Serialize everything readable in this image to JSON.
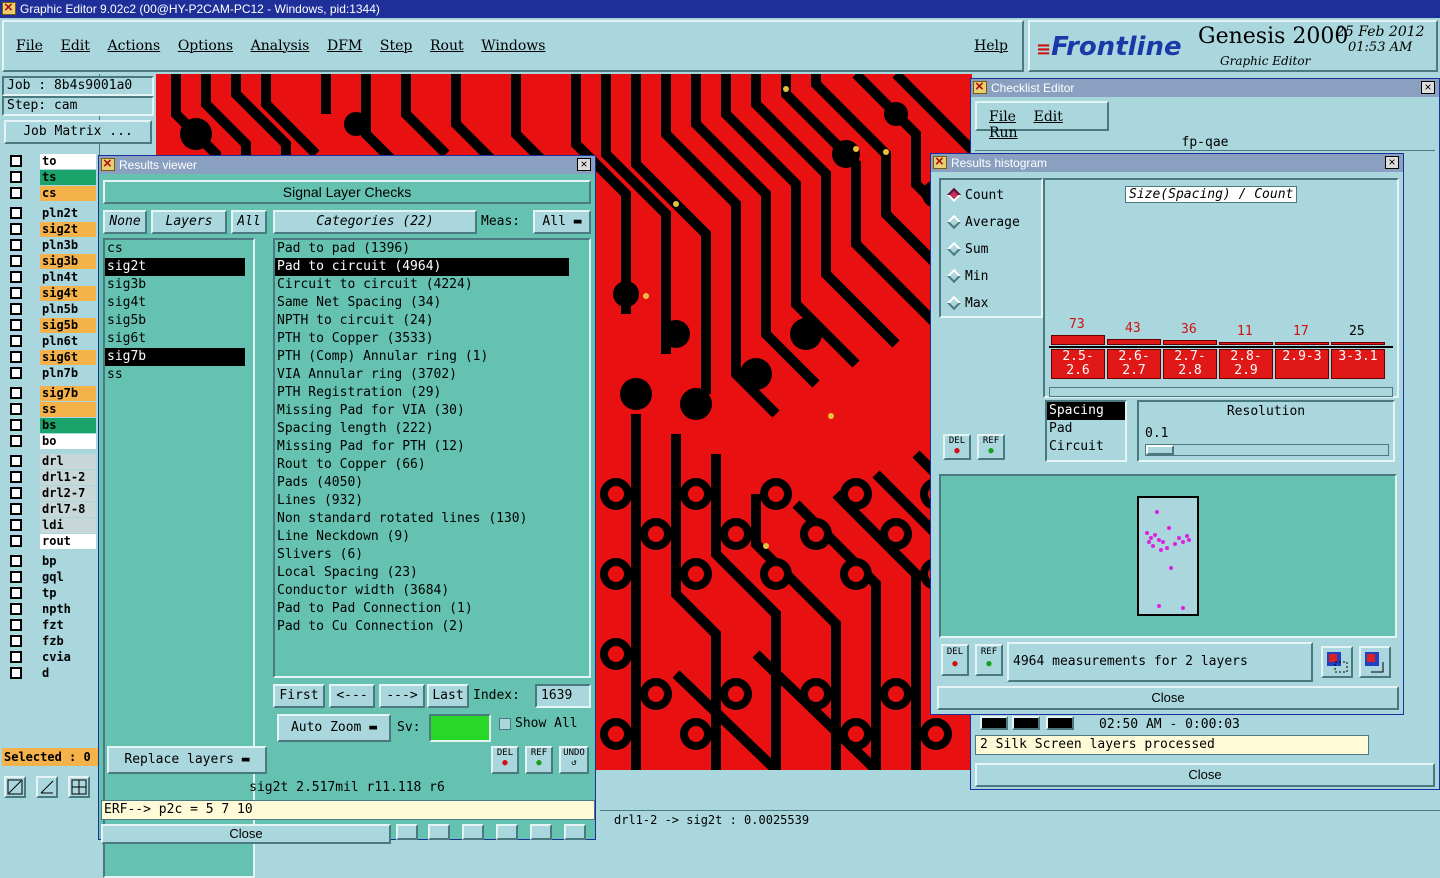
{
  "main_window": {
    "title": "Graphic Editor 9.02c2 (00@HY-P2CAM-PC12 - Windows, pid:1344)"
  },
  "menu": {
    "items": [
      "File",
      "Edit",
      "Actions",
      "Options",
      "Analysis",
      "DFM",
      "Step",
      "Rout",
      "Windows"
    ],
    "help": "Help"
  },
  "brand": {
    "logo": "Frontline",
    "product": "Genesis 2000",
    "subtitle": "Graphic Editor",
    "date": "25 Feb 2012",
    "time": "01:53 AM"
  },
  "job": {
    "job_label": "Job : 8b4s9001a0",
    "step_label": "Step: cam",
    "job_matrix": "Job Matrix ..."
  },
  "layers": [
    {
      "name": "to",
      "color": "#ffffff",
      "group": 0
    },
    {
      "name": "ts",
      "color": "#1aa36a",
      "group": 0
    },
    {
      "name": "cs",
      "color": "#f5b14a",
      "group": 0
    },
    {
      "name": "pln2t",
      "color": "#aad6dd",
      "group": 1
    },
    {
      "name": "sig2t",
      "color": "#f5b14a",
      "group": 1
    },
    {
      "name": "pln3b",
      "color": "#aad6dd",
      "group": 1
    },
    {
      "name": "sig3b",
      "color": "#f5b14a",
      "group": 1
    },
    {
      "name": "pln4t",
      "color": "#aad6dd",
      "group": 1
    },
    {
      "name": "sig4t",
      "color": "#f5b14a",
      "group": 1
    },
    {
      "name": "pln5b",
      "color": "#aad6dd",
      "group": 1
    },
    {
      "name": "sig5b",
      "color": "#f5b14a",
      "group": 1
    },
    {
      "name": "pln6t",
      "color": "#aad6dd",
      "group": 1
    },
    {
      "name": "sig6t",
      "color": "#f5b14a",
      "group": 1
    },
    {
      "name": "pln7b",
      "color": "#aad6dd",
      "group": 1
    },
    {
      "name": "sig7b",
      "color": "#f5b14a",
      "group": 2
    },
    {
      "name": "ss",
      "color": "#f5b14a",
      "group": 2
    },
    {
      "name": "bs",
      "color": "#1aa36a",
      "group": 2
    },
    {
      "name": "bo",
      "color": "#ffffff",
      "group": 2
    },
    {
      "name": "drl",
      "color": "#c8d8d8",
      "group": 3
    },
    {
      "name": "drl1-2",
      "color": "#c8d8d8",
      "group": 3
    },
    {
      "name": "drl2-7",
      "color": "#c8d8d8",
      "group": 3
    },
    {
      "name": "drl7-8",
      "color": "#c8d8d8",
      "group": 3
    },
    {
      "name": "ldi",
      "color": "#c8d8d8",
      "group": 3
    },
    {
      "name": "rout",
      "color": "#ffffff",
      "group": 3
    },
    {
      "name": "bp",
      "color": "#aad6dd",
      "group": 4
    },
    {
      "name": "gql",
      "color": "#aad6dd",
      "group": 4
    },
    {
      "name": "tp",
      "color": "#aad6dd",
      "group": 4
    },
    {
      "name": "npth",
      "color": "#aad6dd",
      "group": 4
    },
    {
      "name": "fzt",
      "color": "#aad6dd",
      "group": 4
    },
    {
      "name": "fzb",
      "color": "#aad6dd",
      "group": 4
    },
    {
      "name": "cvia",
      "color": "#aad6dd",
      "group": 4
    },
    {
      "name": "d",
      "color": "#aad6dd",
      "group": 4
    }
  ],
  "selected_count": "Selected : 0",
  "results_viewer": {
    "title": "Results viewer",
    "header": "Signal Layer Checks",
    "none_btn": "None",
    "layers_btn": "Layers",
    "all_btn": "All",
    "layer_list": [
      "cs",
      "sig2t",
      "sig3b",
      "sig4t",
      "sig5b",
      "sig6t",
      "sig7b",
      "ss"
    ],
    "categories_btn": "Categories (22)",
    "meas_label": "Meas:",
    "meas_value": "All",
    "categories": [
      "Pad to pad (1396)",
      "Pad to circuit (4964)",
      "Circuit to circuit (4224)",
      "Same Net Spacing (34)",
      "NPTH to circuit (24)",
      "PTH to Copper (3533)",
      "PTH (Comp) Annular ring (1)",
      "VIA Annular ring (3702)",
      "PTH Registration (29)",
      "Missing Pad for VIA (30)",
      "Spacing length (222)",
      "Missing Pad for PTH (12)",
      "Rout to Copper (66)",
      "Pads (4050)",
      "Lines (932)",
      "Non standard rotated lines (130)",
      "Line Neckdown (9)",
      "Slivers (6)",
      "Local Spacing (23)",
      "Conductor width (3684)",
      "Pad to Pad Connection (1)",
      "Pad to Cu Connection (2)"
    ],
    "first": "First",
    "prev": "<---",
    "next": "--->",
    "last": "Last",
    "index_label": "Index:",
    "index_value": "1639",
    "auto_zoom": "Auto Zoom",
    "sv_label": "Sv:",
    "show_all": "Show All",
    "replace_layers": "Replace layers",
    "del": "DEL",
    "ref": "REF",
    "undo": "UNDO",
    "status": "sig2t 2.517mil   r11.118   r6",
    "erf": "ERF--> p2c = 5 7 10",
    "close": "Close"
  },
  "checklist": {
    "title": "Checklist Editor",
    "menu": [
      "File",
      "Edit",
      "Run"
    ],
    "name": "fp-qae",
    "time": "02:50 AM - 0:00:03",
    "message": "2 Silk Screen layers processed",
    "close": "Close"
  },
  "histogram": {
    "title": "Results histogram",
    "modes": [
      "Count",
      "Average",
      "Sum",
      "Min",
      "Max"
    ],
    "active_mode": "Count",
    "chart_title": "Size(Spacing) / Count",
    "attr_list": [
      "Spacing",
      "Pad",
      "Circuit"
    ],
    "resolution_label": "Resolution",
    "resolution_value": "0.1",
    "del": "DEL",
    "ref": "REF",
    "measurements": "4964 measurements for 2 layers",
    "close": "Close"
  },
  "chart_data": {
    "type": "bar",
    "categories": [
      "2.5-2.6",
      "2.6-2.7",
      "2.7-2.8",
      "2.8-2.9",
      "2.9-3",
      "3-3.1"
    ],
    "values": [
      73,
      43,
      36,
      11,
      17,
      25
    ],
    "title": "Size(Spacing) / Count"
  },
  "bottom_status": "drl1-2 -> sig2t : 0.0025539"
}
